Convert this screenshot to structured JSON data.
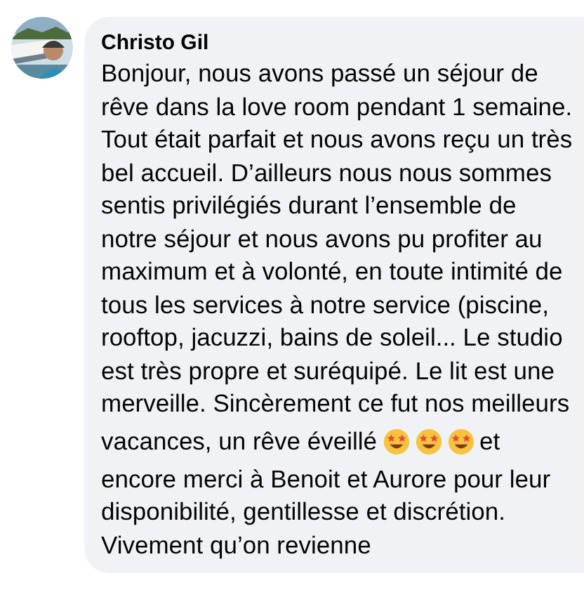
{
  "comment": {
    "author": "Christo Gil",
    "body": [
      {
        "kind": "paragraph",
        "text": "Bonjour, nous avons passé un séjour de rêve dans la love room pendant 1 semaine. Tout était parfait et nous avons reçu un très bel accueil. D’ailleurs nous nous sommes sentis privilégiés durant l’ensemble de notre séjour et nous avons pu profiter au maximum et à volonté, en toute intimité de tous les services à notre service (piscine, rooftop, jacuzzi, bains de soleil... Le studio est très propre et suréquipé. Le lit est une merveille. Sincèrement ce fut nos meilleurs"
      },
      {
        "kind": "line",
        "parts": [
          {
            "kind": "text",
            "text": "vacances, un rêve éveillé"
          },
          {
            "kind": "emoji"
          },
          {
            "kind": "emoji"
          },
          {
            "kind": "emoji"
          },
          {
            "kind": "text",
            "text": "et"
          }
        ]
      },
      {
        "kind": "paragraph",
        "text": "encore merci à Benoit et Aurore pour leur disponibilité, gentillesse et discrétion. Vivement qu’on revienne"
      }
    ]
  }
}
